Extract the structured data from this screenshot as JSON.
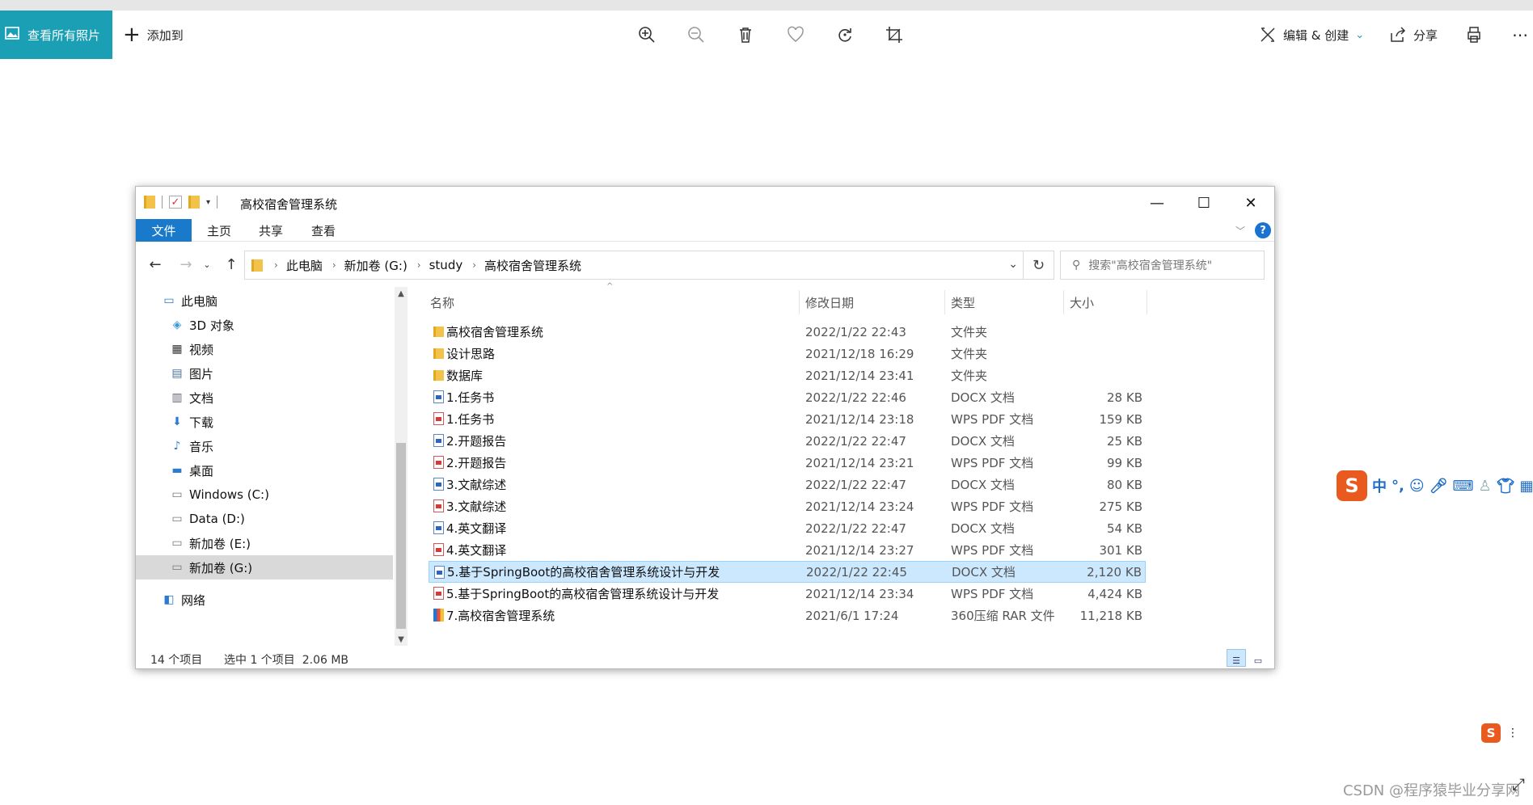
{
  "photos_app": {
    "view_all_label": "查看所有照片",
    "add_to_label": "添加到",
    "edit_create_label": "编辑 & 创建",
    "share_label": "分享"
  },
  "window": {
    "title": "高校宿舍管理系统",
    "ribbon_tabs": [
      "文件",
      "主页",
      "共享",
      "查看"
    ],
    "address": [
      "此电脑",
      "新加卷 (G:)",
      "study",
      "高校宿舍管理系统"
    ],
    "search_placeholder": "搜索\"高校宿舍管理系统\""
  },
  "nav": [
    {
      "label": "此电脑",
      "icon": "computer-icon"
    },
    {
      "label": "3D 对象",
      "icon": "3d-objects-icon"
    },
    {
      "label": "视频",
      "icon": "video-icon"
    },
    {
      "label": "图片",
      "icon": "pictures-icon"
    },
    {
      "label": "文档",
      "icon": "documents-icon"
    },
    {
      "label": "下载",
      "icon": "download-icon"
    },
    {
      "label": "音乐",
      "icon": "music-icon"
    },
    {
      "label": "桌面",
      "icon": "desktop-icon"
    },
    {
      "label": "Windows (C:)",
      "icon": "drive-icon"
    },
    {
      "label": "Data (D:)",
      "icon": "drive-icon"
    },
    {
      "label": "新加卷 (E:)",
      "icon": "drive-icon"
    },
    {
      "label": "新加卷 (G:)",
      "icon": "drive-icon"
    },
    {
      "label": "网络",
      "icon": "network-icon"
    }
  ],
  "columns": {
    "name": "名称",
    "date": "修改日期",
    "type": "类型",
    "size": "大小"
  },
  "files": [
    {
      "name": "高校宿舍管理系统",
      "date": "2022/1/22 22:43",
      "type": "文件夹",
      "size": "",
      "kind": "folder"
    },
    {
      "name": "设计思路",
      "date": "2021/12/18 16:29",
      "type": "文件夹",
      "size": "",
      "kind": "folder"
    },
    {
      "name": "数据库",
      "date": "2021/12/14 23:41",
      "type": "文件夹",
      "size": "",
      "kind": "folder"
    },
    {
      "name": "1.任务书",
      "date": "2022/1/22 22:46",
      "type": "DOCX 文档",
      "size": "28 KB",
      "kind": "docx"
    },
    {
      "name": "1.任务书",
      "date": "2021/12/14 23:18",
      "type": "WPS PDF 文档",
      "size": "159 KB",
      "kind": "pdf"
    },
    {
      "name": "2.开题报告",
      "date": "2022/1/22 22:47",
      "type": "DOCX 文档",
      "size": "25 KB",
      "kind": "docx"
    },
    {
      "name": "2.开题报告",
      "date": "2021/12/14 23:21",
      "type": "WPS PDF 文档",
      "size": "99 KB",
      "kind": "pdf"
    },
    {
      "name": "3.文献综述",
      "date": "2022/1/22 22:47",
      "type": "DOCX 文档",
      "size": "80 KB",
      "kind": "docx"
    },
    {
      "name": "3.文献综述",
      "date": "2021/12/14 23:24",
      "type": "WPS PDF 文档",
      "size": "275 KB",
      "kind": "pdf"
    },
    {
      "name": "4.英文翻译",
      "date": "2022/1/22 22:47",
      "type": "DOCX 文档",
      "size": "54 KB",
      "kind": "docx"
    },
    {
      "name": "4.英文翻译",
      "date": "2021/12/14 23:27",
      "type": "WPS PDF 文档",
      "size": "301 KB",
      "kind": "pdf"
    },
    {
      "name": "5.基于SpringBoot的高校宿舍管理系统设计与开发",
      "date": "2022/1/22 22:45",
      "type": "DOCX 文档",
      "size": "2,120 KB",
      "kind": "docx"
    },
    {
      "name": "5.基于SpringBoot的高校宿舍管理系统设计与开发",
      "date": "2021/12/14 23:34",
      "type": "WPS PDF 文档",
      "size": "4,424 KB",
      "kind": "pdf"
    },
    {
      "name": "7.高校宿舍管理系统",
      "date": "2021/6/1 17:24",
      "type": "360压缩 RAR 文件",
      "size": "11,218 KB",
      "kind": "rar"
    }
  ],
  "selected_index": 11,
  "status": {
    "count": "14 个项目",
    "selection": "选中 1 个项目  2.06 MB"
  },
  "ime": {
    "zh": "中",
    "punct": "°,"
  },
  "watermark": "CSDN @程序猿毕业分享网",
  "colors": {
    "accent": "#1a9fb4",
    "file_tab": "#1979ca",
    "selection": "#cce8ff"
  }
}
